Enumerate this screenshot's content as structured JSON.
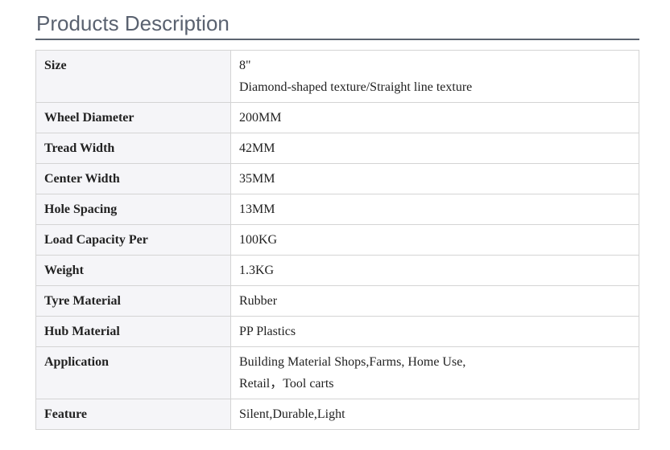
{
  "section": {
    "title": "Products Description"
  },
  "specs": [
    {
      "label": "Size",
      "lines": [
        "8\"",
        "Diamond-shaped texture/Straight line texture"
      ]
    },
    {
      "label": "Wheel Diameter",
      "lines": [
        "200MM"
      ]
    },
    {
      "label": "Tread Width",
      "lines": [
        "42MM"
      ]
    },
    {
      "label": "Center Width",
      "lines": [
        "35MM"
      ]
    },
    {
      "label": "Hole Spacing",
      "lines": [
        "13MM"
      ]
    },
    {
      "label": "Load Capacity Per",
      "lines": [
        "100KG"
      ]
    },
    {
      "label": "Weight",
      "lines": [
        "1.3KG"
      ]
    },
    {
      "label": "Tyre Material",
      "lines": [
        "Rubber"
      ]
    },
    {
      "label": "Hub Material",
      "lines": [
        "PP Plastics"
      ]
    },
    {
      "label": "Application",
      "lines": [
        "Building Material Shops,Farms, Home Use,",
        "Retail，Tool carts"
      ]
    },
    {
      "label": "Feature",
      "lines": [
        "Silent,Durable,Light"
      ]
    }
  ]
}
